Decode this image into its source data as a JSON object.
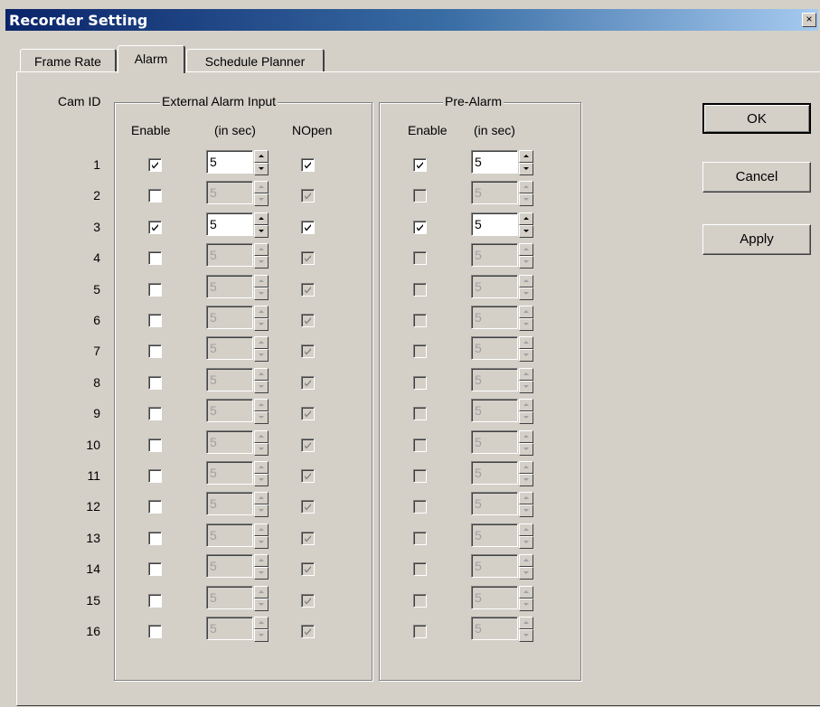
{
  "window": {
    "title": "Recorder Setting",
    "close_glyph": "×"
  },
  "tabs": [
    {
      "label": "Frame Rate",
      "active": false
    },
    {
      "label": "Alarm",
      "active": true
    },
    {
      "label": "Schedule Planner",
      "active": false
    }
  ],
  "columns": {
    "cam_id": "Cam ID",
    "external_group": "External Alarm Input",
    "ext_enable": "Enable",
    "ext_in_sec": "(in sec)",
    "ext_nopen": "NOpen",
    "pre_group": "Pre-Alarm",
    "pre_enable": "Enable",
    "pre_in_sec": "(in sec)"
  },
  "rows": [
    {
      "cam": "1",
      "ext_enabled": true,
      "ext_sec": "5",
      "nopen": true,
      "pre_enabled": true,
      "pre_sec": "5"
    },
    {
      "cam": "2",
      "ext_enabled": false,
      "ext_sec": "5",
      "nopen": true,
      "pre_enabled": false,
      "pre_sec": "5"
    },
    {
      "cam": "3",
      "ext_enabled": true,
      "ext_sec": "5",
      "nopen": true,
      "pre_enabled": true,
      "pre_sec": "5"
    },
    {
      "cam": "4",
      "ext_enabled": false,
      "ext_sec": "5",
      "nopen": true,
      "pre_enabled": false,
      "pre_sec": "5"
    },
    {
      "cam": "5",
      "ext_enabled": false,
      "ext_sec": "5",
      "nopen": true,
      "pre_enabled": false,
      "pre_sec": "5"
    },
    {
      "cam": "6",
      "ext_enabled": false,
      "ext_sec": "5",
      "nopen": true,
      "pre_enabled": false,
      "pre_sec": "5"
    },
    {
      "cam": "7",
      "ext_enabled": false,
      "ext_sec": "5",
      "nopen": true,
      "pre_enabled": false,
      "pre_sec": "5"
    },
    {
      "cam": "8",
      "ext_enabled": false,
      "ext_sec": "5",
      "nopen": true,
      "pre_enabled": false,
      "pre_sec": "5"
    },
    {
      "cam": "9",
      "ext_enabled": false,
      "ext_sec": "5",
      "nopen": true,
      "pre_enabled": false,
      "pre_sec": "5"
    },
    {
      "cam": "10",
      "ext_enabled": false,
      "ext_sec": "5",
      "nopen": true,
      "pre_enabled": false,
      "pre_sec": "5"
    },
    {
      "cam": "11",
      "ext_enabled": false,
      "ext_sec": "5",
      "nopen": true,
      "pre_enabled": false,
      "pre_sec": "5"
    },
    {
      "cam": "12",
      "ext_enabled": false,
      "ext_sec": "5",
      "nopen": true,
      "pre_enabled": false,
      "pre_sec": "5"
    },
    {
      "cam": "13",
      "ext_enabled": false,
      "ext_sec": "5",
      "nopen": true,
      "pre_enabled": false,
      "pre_sec": "5"
    },
    {
      "cam": "14",
      "ext_enabled": false,
      "ext_sec": "5",
      "nopen": true,
      "pre_enabled": false,
      "pre_sec": "5"
    },
    {
      "cam": "15",
      "ext_enabled": false,
      "ext_sec": "5",
      "nopen": true,
      "pre_enabled": false,
      "pre_sec": "5"
    },
    {
      "cam": "16",
      "ext_enabled": false,
      "ext_sec": "5",
      "nopen": true,
      "pre_enabled": false,
      "pre_sec": "5"
    }
  ],
  "buttons": {
    "ok": "OK",
    "cancel": "Cancel",
    "apply": "Apply"
  },
  "colors": {
    "titlebar_start": "#0a246a",
    "titlebar_end": "#a6caf0",
    "face": "#d4d0c8",
    "disabled_text": "#a0a0a0"
  },
  "icons": {
    "checkbox": "checkmark-icon",
    "spin_up": "arrow-up-icon",
    "spin_down": "arrow-down-icon",
    "close": "close-icon"
  }
}
